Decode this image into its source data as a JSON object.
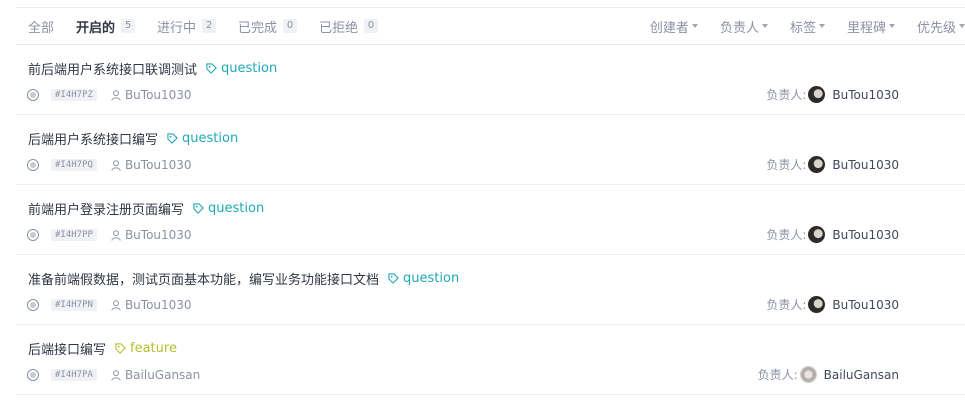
{
  "tabs": [
    {
      "label": "全部",
      "count": ""
    },
    {
      "label": "开启的",
      "count": "5"
    },
    {
      "label": "进行中",
      "count": "2"
    },
    {
      "label": "已完成",
      "count": "0"
    },
    {
      "label": "已拒绝",
      "count": "0"
    }
  ],
  "filters": [
    "创建者",
    "负责人",
    "标签",
    "里程碑",
    "优先级"
  ],
  "assignee_prefix": "负责人:",
  "issues": [
    {
      "title": "前后端用户系统接口联调测试",
      "label": "question",
      "id": "#I4H7PZ",
      "author": "BuTou1030",
      "assignee": "BuTou1030"
    },
    {
      "title": "后端用户系统接口编写",
      "label": "question",
      "id": "#I4H7PQ",
      "author": "BuTou1030",
      "assignee": "BuTou1030"
    },
    {
      "title": "前端用户登录注册页面编写",
      "label": "question",
      "id": "#I4H7PP",
      "author": "BuTou1030",
      "assignee": "BuTou1030"
    },
    {
      "title": "准备前端假数据，测试页面基本功能，编写业务功能接口文档",
      "label": "question",
      "id": "#I4H7PN",
      "author": "BuTou1030",
      "assignee": "BuTou1030"
    },
    {
      "title": "后端接口编写",
      "label": "feature",
      "id": "#I4H7PA",
      "author": "BailuGansan",
      "assignee": "BailuGansan"
    }
  ],
  "colors": {
    "question": "#1fa9b6",
    "feature": "#b8bd2b",
    "muted": "#8c92a4"
  },
  "icons": {
    "label": "tag-icon",
    "author": "user-icon",
    "state": "open-state-icon"
  }
}
